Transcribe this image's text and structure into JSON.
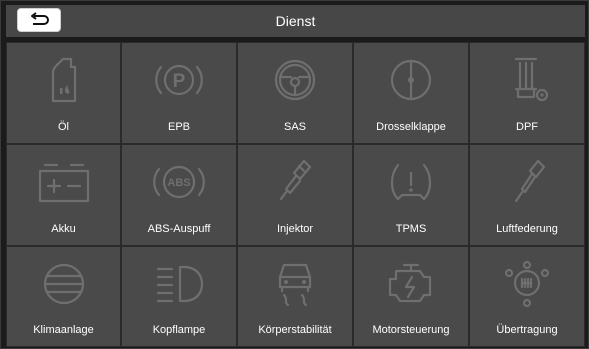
{
  "header": {
    "title": "Dienst",
    "back_icon": "return-arrow-icon"
  },
  "tiles": [
    {
      "label": "Öl",
      "icon": "oil-can-icon"
    },
    {
      "label": "EPB",
      "icon": "parking-brake-icon"
    },
    {
      "label": "SAS",
      "icon": "steering-wheel-icon"
    },
    {
      "label": "Drosselklappe",
      "icon": "throttle-icon"
    },
    {
      "label": "DPF",
      "icon": "particulate-filter-icon"
    },
    {
      "label": "Akku",
      "icon": "battery-icon"
    },
    {
      "label": "ABS-Auspuff",
      "icon": "abs-icon"
    },
    {
      "label": "Injektor",
      "icon": "injector-icon"
    },
    {
      "label": "TPMS",
      "icon": "tire-pressure-icon"
    },
    {
      "label": "Luftfederung",
      "icon": "air-suspension-icon"
    },
    {
      "label": "Klimaanlage",
      "icon": "air-conditioning-icon"
    },
    {
      "label": "Kopflampe",
      "icon": "headlamp-icon"
    },
    {
      "label": "Körperstabilität",
      "icon": "stability-control-icon"
    },
    {
      "label": "Motorsteuerung",
      "icon": "engine-icon"
    },
    {
      "label": "Übertragung",
      "icon": "transmission-icon"
    }
  ],
  "colors": {
    "background": "#1b1b1b",
    "header": "#474747",
    "tile": "#4a4a4a",
    "icon": "#6f6f6f",
    "text": "#ffffff"
  }
}
